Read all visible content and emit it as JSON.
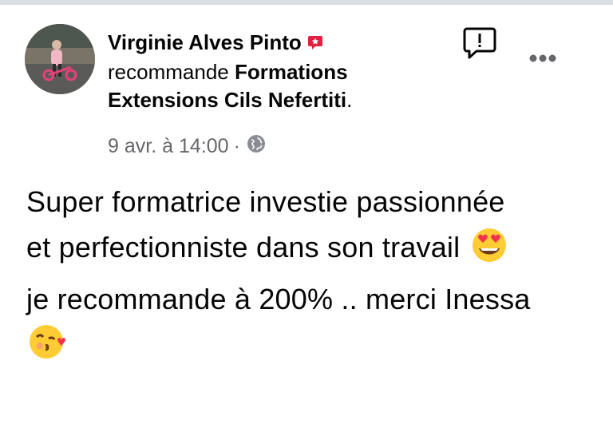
{
  "post": {
    "author_name": "Virginie Alves Pinto",
    "action_text": "recommande",
    "page_name": "Formations Extensions Cils Nefertiti",
    "page_suffix": ".",
    "timestamp": "9 avr. à 14:00",
    "separator": "·",
    "privacy_icon": "globe-icon",
    "text_part1": "Super formatrice investie passionnée et perfectionniste dans son travail",
    "emoji1": "heart-eyes-emoji",
    "text_part2": "je recommande à 200% .. merci Inessa",
    "emoji2": "kissing-heart-emoji"
  },
  "icons": {
    "badge": "recommendation-badge-icon",
    "report": "report-icon",
    "more": "more-options-icon"
  },
  "colors": {
    "text": "#050505",
    "secondary": "#65676b",
    "badge": "#e41e3f",
    "top_bar": "#dadde1"
  }
}
